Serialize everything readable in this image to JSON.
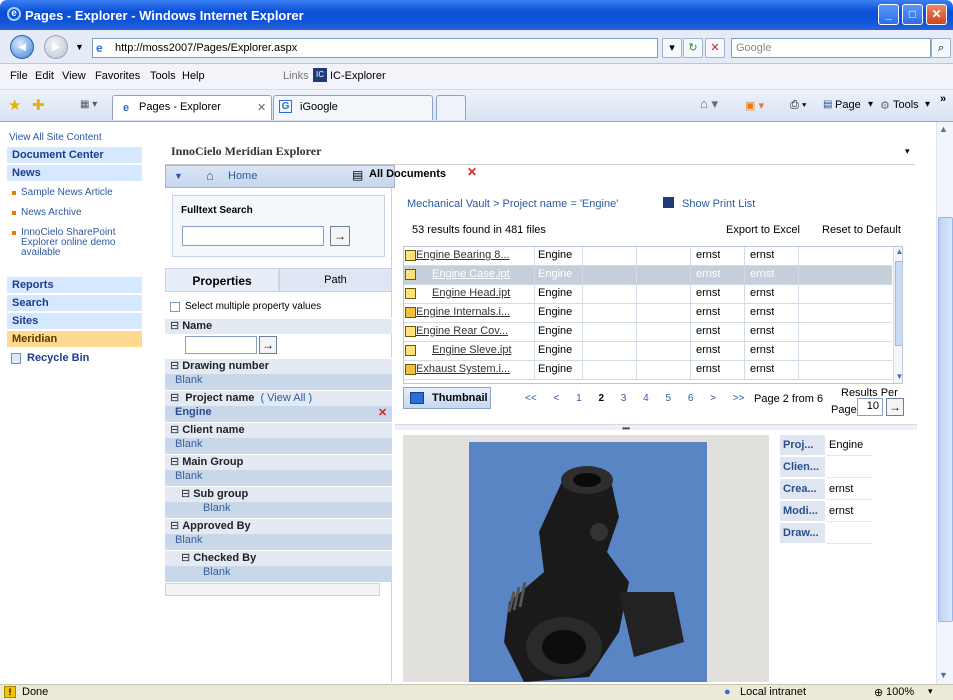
{
  "window": {
    "title": "Pages - Explorer - Windows Internet Explorer",
    "min": "_",
    "max": "□",
    "close": "✕"
  },
  "address": {
    "url": "http://moss2007/Pages/Explorer.aspx",
    "search_placeholder": "Google",
    "back": "◄",
    "forward": "►"
  },
  "menu": {
    "items": [
      "File",
      "Edit",
      "View",
      "Favorites",
      "Tools",
      "Help"
    ],
    "links": "Links",
    "link1": "IC-Explorer"
  },
  "tabs": {
    "active": "Pages - Explorer",
    "second": "iGoogle",
    "tools": [
      "Page",
      "Tools"
    ]
  },
  "leftnav": {
    "view_all": "View All Site Content",
    "document_center": "Document Center",
    "news": "News",
    "news_items": [
      "Sample News Article",
      "News Archive",
      "InnoCielo SharePoint Explorer online demo available"
    ],
    "reports": "Reports",
    "search": "Search",
    "sites": "Sites",
    "meridian": "Meridian",
    "recycle": "Recycle Bin"
  },
  "webpart": {
    "title": "InnoCielo Meridian Explorer",
    "home": "Home",
    "all_documents": "All Documents"
  },
  "search": {
    "label": "Fulltext Search",
    "go": "→"
  },
  "panel": {
    "tab_properties": "Properties",
    "tab_path": "Path",
    "multi": "Select multiple property values",
    "name": "Name",
    "drawing_number": "Drawing number",
    "blank": "Blank",
    "project_name": "Project name",
    "view_all": "( View All )",
    "project_value": "Engine",
    "client_name": "Client name",
    "main_group": "Main Group",
    "sub_group": "Sub group",
    "approved_by": "Approved By",
    "checked_by": "Checked By"
  },
  "results": {
    "breadcrumb": "Mechanical Vault > Project name = 'Engine'",
    "print_list": "Show Print List",
    "count": "53 results found in 481 files",
    "export": "Export to Excel",
    "reset": "Reset to Default",
    "rows": [
      {
        "name": "Engine Bearing 8...",
        "project": "Engine",
        "c1": "ernst",
        "c2": "ernst"
      },
      {
        "name": "Engine Case.ipt",
        "project": "Engine",
        "c1": "ernst",
        "c2": "ernst"
      },
      {
        "name": "Engine Head.ipt",
        "project": "Engine",
        "c1": "ernst",
        "c2": "ernst"
      },
      {
        "name": "Engine Internals.i...",
        "project": "Engine",
        "c1": "ernst",
        "c2": "ernst"
      },
      {
        "name": "Engine Rear Cov...",
        "project": "Engine",
        "c1": "ernst",
        "c2": "ernst"
      },
      {
        "name": "Engine Sleve.ipt",
        "project": "Engine",
        "c1": "ernst",
        "c2": "ernst"
      },
      {
        "name": "Exhaust System.i...",
        "project": "Engine",
        "c1": "ernst",
        "c2": "ernst"
      }
    ],
    "thumbnail": "Thumbnail",
    "pager": [
      "<<",
      "<",
      "1",
      "2",
      "3",
      "4",
      "5",
      "6",
      ">",
      ">>"
    ],
    "page_text": "Page 2 from 6",
    "results_per": "Results Per",
    "page_label": "Page",
    "per_page": "10"
  },
  "properties": [
    {
      "k": "Proj...",
      "v": "Engine"
    },
    {
      "k": "Clien...",
      "v": ""
    },
    {
      "k": "Crea...",
      "v": "ernst"
    },
    {
      "k": "Modi...",
      "v": "ernst"
    },
    {
      "k": "Draw...",
      "v": ""
    }
  ],
  "status": {
    "done": "Done",
    "zone": "Local intranet",
    "zoom": "100%"
  }
}
